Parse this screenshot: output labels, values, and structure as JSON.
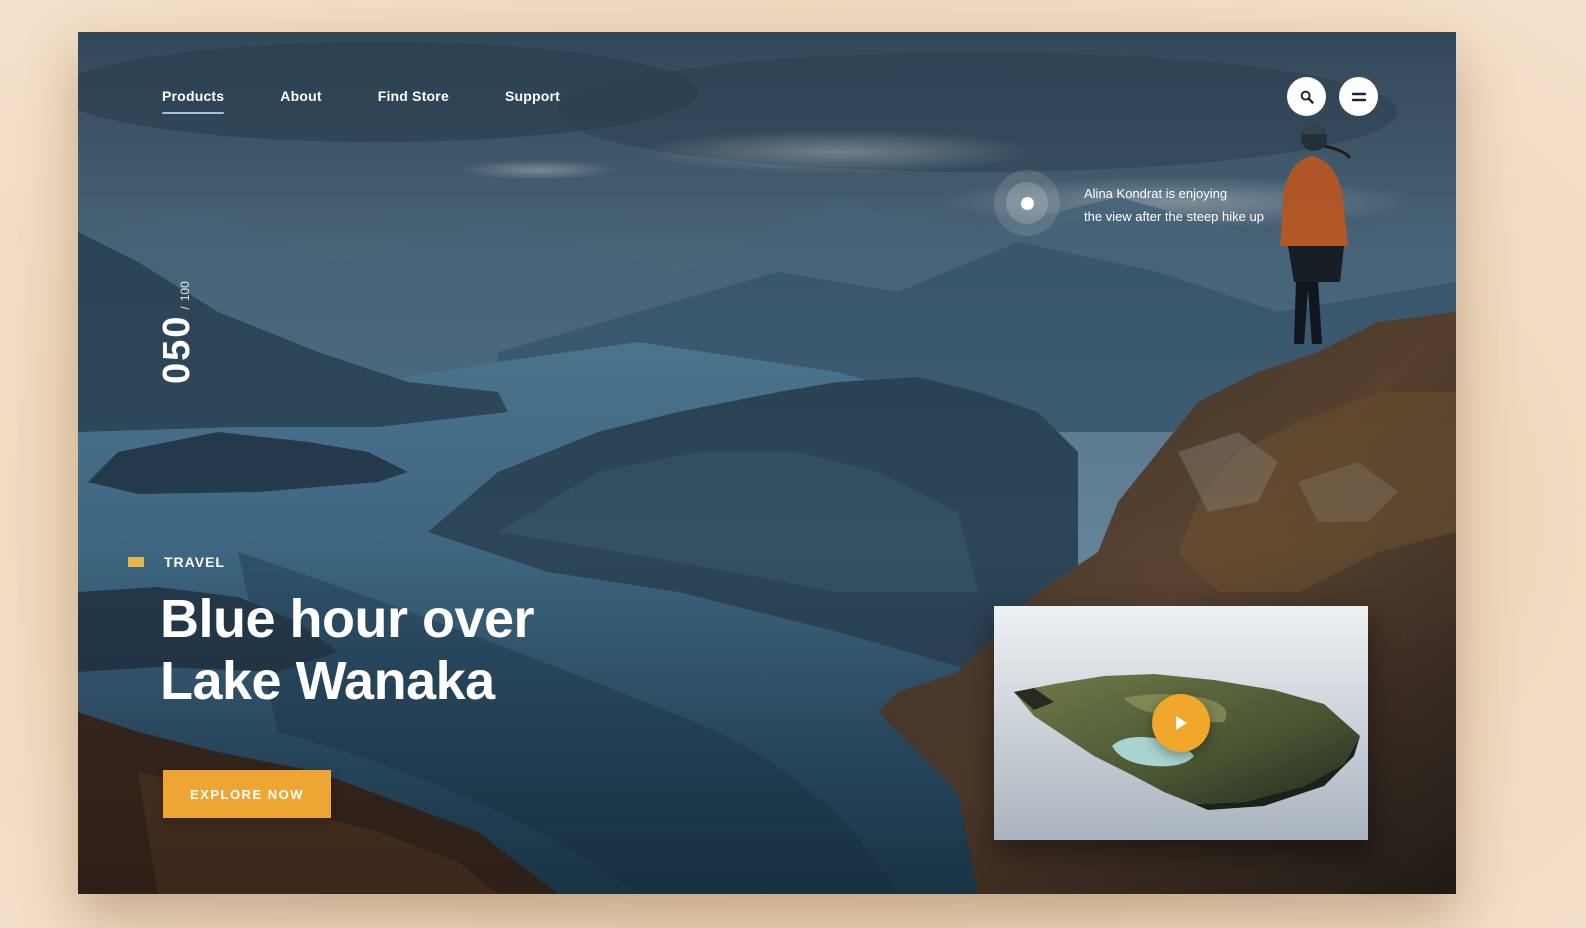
{
  "nav": {
    "items": [
      {
        "label": "Products",
        "active": true
      },
      {
        "label": "About",
        "active": false
      },
      {
        "label": "Find Store",
        "active": false
      },
      {
        "label": "Support",
        "active": false
      }
    ]
  },
  "header_icons": {
    "search": "search-icon",
    "menu": "menu-icon"
  },
  "counter": {
    "current": "050",
    "separator": "/",
    "total": "100"
  },
  "hotspot": {
    "caption_line1": "Alina Kondrat is enjoying",
    "caption_line2": "the view after the steep hike up"
  },
  "hero": {
    "category": "TRAVEL",
    "title_line1": "Blue hour over",
    "title_line2": "Lake Wanaka",
    "cta_label": "EXPLORE NOW"
  },
  "video": {
    "play_icon": "play-icon"
  },
  "colors": {
    "accent": "#eda634",
    "category_swatch": "#e7b64a",
    "play_button": "#f0a72a",
    "page_background": "#efd7bc"
  }
}
